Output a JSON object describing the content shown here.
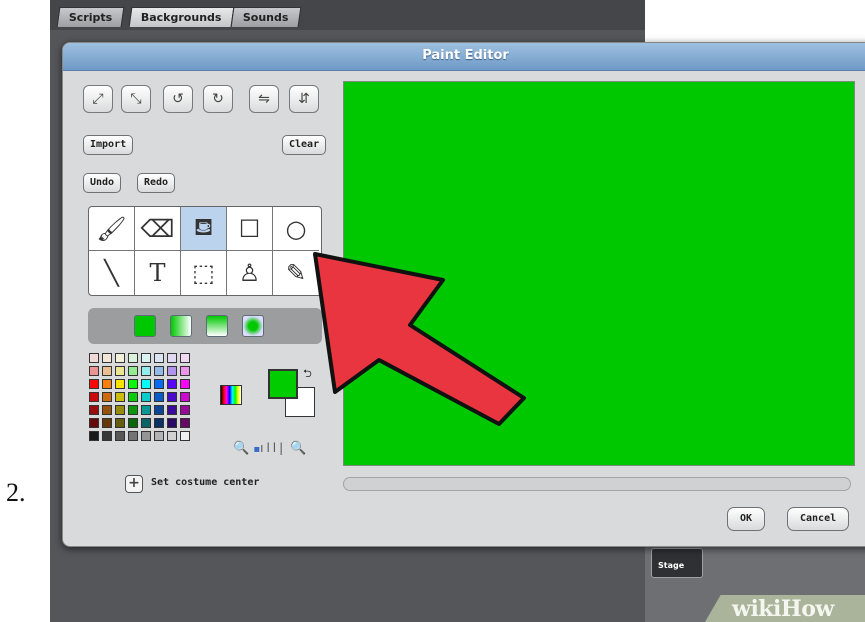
{
  "background": {
    "tabs": [
      "Scripts",
      "Backgrounds",
      "Sounds"
    ],
    "stage_label": "Stage",
    "watermark_wiki": "wiki",
    "watermark_how": "How"
  },
  "step_number": "2.",
  "dialog": {
    "title": "Paint Editor",
    "import_label": "Import",
    "clear_label": "Clear",
    "undo_label": "Undo",
    "redo_label": "Redo",
    "set_center_label": "Set costume center",
    "ok_label": "OK",
    "cancel_label": "Cancel",
    "canvas_color": "#00c800",
    "foreground_color": "#00cc00",
    "background_color": "#ffffff"
  },
  "tools": [
    "brush",
    "eraser",
    "fill",
    "rectangle",
    "ellipse",
    "line",
    "text",
    "select",
    "stamp",
    "eyedropper"
  ],
  "selected_tool": "fill",
  "annotation": {
    "color": "#e8353f"
  }
}
